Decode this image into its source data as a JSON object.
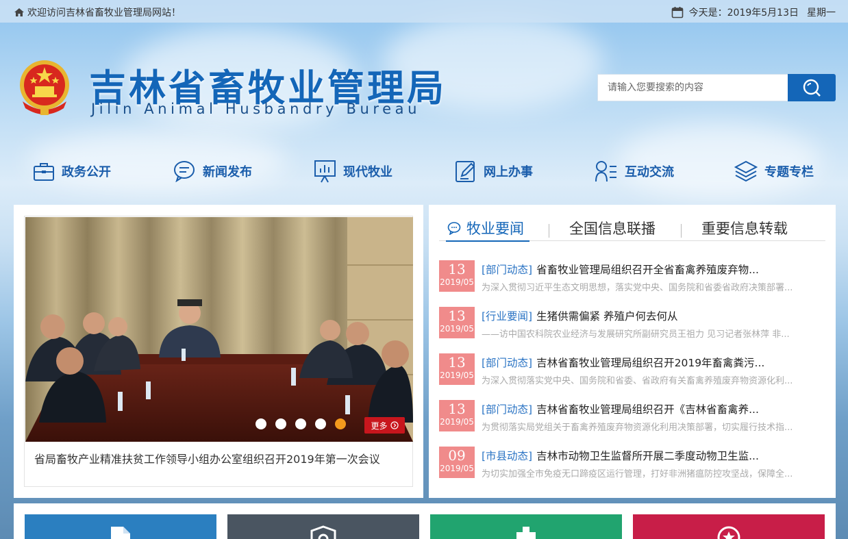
{
  "topbar": {
    "welcome": "欢迎访问吉林省畜牧业管理局网站！",
    "date_prefix": "今天是：",
    "date": "2019年5月13日",
    "weekday": "星期一"
  },
  "header": {
    "title": "吉林省畜牧业管理局",
    "subtitle": "Jilin Animal Husbandry Bureau"
  },
  "search": {
    "placeholder": "请输入您要搜索的内容",
    "button_icon": "search-icon"
  },
  "nav": {
    "items": [
      {
        "label": "政务公开",
        "icon": "briefcase-icon"
      },
      {
        "label": "新闻发布",
        "icon": "chat-bubble-icon"
      },
      {
        "label": "现代牧业",
        "icon": "presentation-chart-icon"
      },
      {
        "label": "网上办事",
        "icon": "edit-document-icon"
      },
      {
        "label": "互动交流",
        "icon": "user-list-icon"
      },
      {
        "label": "专题专栏",
        "icon": "layers-icon"
      }
    ]
  },
  "slider": {
    "caption": "省局畜牧产业精准扶贫工作领导小组办公室组织召开2019年第一次会议",
    "more_label": "更多",
    "slide_count": 5,
    "active_slide": 5
  },
  "news_tabs": [
    {
      "label": "牧业要闻",
      "active": true
    },
    {
      "label": "全国信息联播",
      "active": false
    },
    {
      "label": "重要信息转载",
      "active": false
    }
  ],
  "news": [
    {
      "day": "13",
      "ym": "2019/05",
      "tag": "[部门动态]",
      "title": "省畜牧业管理局组织召开全省畜禽养殖废弃物...",
      "summary": "为深入贯彻习近平生态文明思想，落实党中央、国务院和省委省政府决策部署..."
    },
    {
      "day": "13",
      "ym": "2019/05",
      "tag": "[行业要闻]",
      "title": "生猪供需偏紧 养殖户何去何从",
      "summary": "——访中国农科院农业经济与发展研究所副研究员王祖力 见习记者张林萍 非..."
    },
    {
      "day": "13",
      "ym": "2019/05",
      "tag": "[部门动态]",
      "title": "吉林省畜牧业管理局组织召开2019年畜禽粪污...",
      "summary": "为深入贯彻落实党中央、国务院和省委、省政府有关畜禽养殖废弃物资源化利..."
    },
    {
      "day": "13",
      "ym": "2019/05",
      "tag": "[部门动态]",
      "title": "吉林省畜牧业管理局组织召开《吉林省畜禽养...",
      "summary": "为贯彻落实局党组关于畜禽养殖废弃物资源化利用决策部署，切实履行技术指..."
    },
    {
      "day": "09",
      "ym": "2019/05",
      "tag": "[市县动态]",
      "title": "吉林市动物卫生监督所开展二季度动物卫生监...",
      "summary": "为切实加强全市免疫无口蹄疫区运行管理，打好非洲猪瘟防控攻坚战，保障全..."
    }
  ],
  "colors": {
    "brand_blue": "#1466b8",
    "date_badge": "#f08b8b",
    "tag_blue": "#2b74c4",
    "tile_1": "#2b7fc0",
    "tile_2": "#4a5561",
    "tile_3": "#21a46f",
    "tile_4": "#c81e48"
  },
  "bottom_tiles": [
    {
      "icon": "document-icon"
    },
    {
      "icon": "shield-icon"
    },
    {
      "icon": "hospital-icon"
    },
    {
      "icon": "star-badge-icon"
    }
  ]
}
